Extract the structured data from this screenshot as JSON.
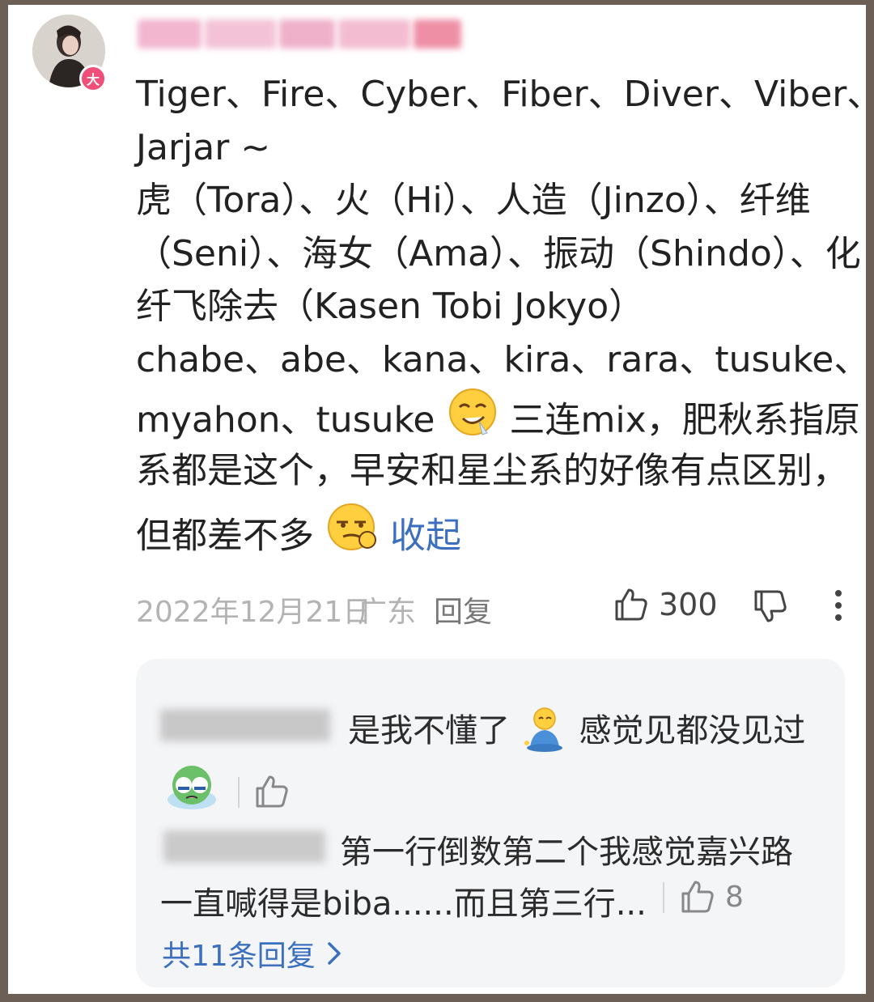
{
  "comment": {
    "avatar_badge": "大",
    "lines": [
      "Tiger、Fire、Cyber、Fiber、Diver、Viber、",
      "Jarjar ~",
      "虎（Tora）、火（Hi）、人造（Jinzo）、纤维",
      "（Seni）、海女（Ama）、振动（Shindo）、化",
      "纤飞除去（Kasen Tobi Jokyo）",
      "chabe、abe、kana、kira、rara、tusuke、"
    ],
    "line7_before_emoji": "myahon、tusuke",
    "line7_after_emoji": "三连mix，肥秋系指原",
    "line8": "系都是这个，早安和星尘系的好像有点区别，",
    "line9_before_emoji": "但都差不多",
    "collapse_label": "收起"
  },
  "meta": {
    "date": "2022年12月21日",
    "location": "广东",
    "reply_label": "回复",
    "like_count": "300"
  },
  "replies": {
    "reply1_text_a": "是我不懂了",
    "reply1_text_b": "感觉见都没见过",
    "reply2_line1": "第一行倒数第二个我感觉嘉兴路",
    "reply2_line2": "一直喊得是biba......而且第三行...",
    "reply2_like_count": "8",
    "more_replies_label": "共11条回复"
  },
  "colors": {
    "link": "#3d6fbf",
    "badge": "#ef4f79"
  }
}
